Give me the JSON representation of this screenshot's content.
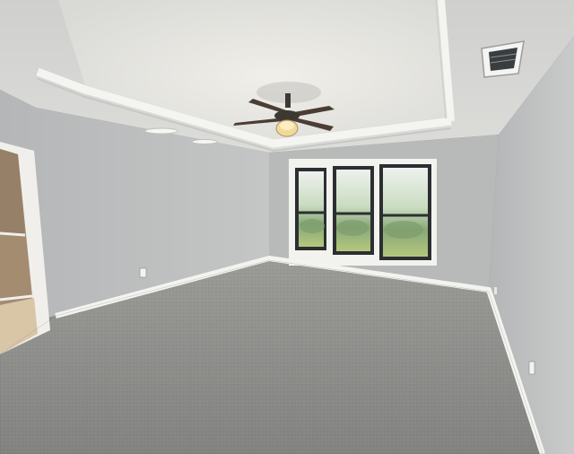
{
  "scene": {
    "kind": "empty carpeted bedroom interior",
    "colors": {
      "wall": "#b9bbbb",
      "wall_shadow": "#a7a9aa",
      "ceiling": "#d7d7d5",
      "tray_ceiling": "#e6e5e1",
      "trim": "#f2f2ef",
      "carpet": "#8b8b88",
      "window_frame": "#2c2f31",
      "window_view": "#9fbe86",
      "doorway": "#a48c70",
      "fan_blade": "#4b3d33"
    },
    "objects": [
      "ceiling-fan",
      "tray-ceiling",
      "triple-window",
      "hvac-vent",
      "open-doorway",
      "carpet-floor",
      "baseboards",
      "wall-outlets"
    ]
  }
}
